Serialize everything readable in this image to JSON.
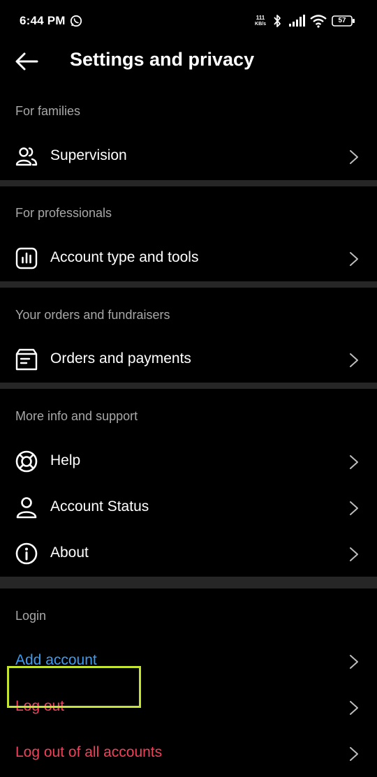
{
  "status_bar": {
    "time": "6:44 PM",
    "net_speed_value": "111",
    "net_speed_unit": "KB/s",
    "battery": "57"
  },
  "header": {
    "title": "Settings and privacy",
    "back_icon": "arrow-left-icon"
  },
  "sections": {
    "families": {
      "label": "For families",
      "items": [
        {
          "label": "Supervision",
          "icon": "supervision-icon"
        }
      ]
    },
    "professionals": {
      "label": "For professionals",
      "items": [
        {
          "label": "Account type and tools",
          "icon": "bar-chart-icon"
        }
      ]
    },
    "orders": {
      "label": "Your orders and fundraisers",
      "items": [
        {
          "label": "Orders and payments",
          "icon": "orders-icon"
        }
      ]
    },
    "support": {
      "label": "More info and support",
      "items": [
        {
          "label": "Help",
          "icon": "lifebuoy-icon"
        },
        {
          "label": "Account Status",
          "icon": "person-icon"
        },
        {
          "label": "About",
          "icon": "info-icon"
        }
      ]
    },
    "login": {
      "label": "Login",
      "items": [
        {
          "label": "Add account",
          "color": "#3d9cf0"
        },
        {
          "label": "Log out",
          "color": "#f0415a"
        },
        {
          "label": "Log out of all accounts",
          "color": "#f0415a"
        }
      ]
    }
  },
  "colors": {
    "background": "#000000",
    "divider": "#262626",
    "section_label": "#a8a8a8",
    "highlight": "#c3e532"
  }
}
